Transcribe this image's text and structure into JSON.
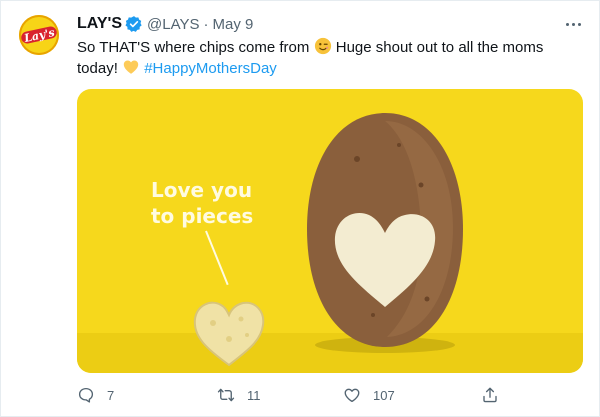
{
  "tweet": {
    "author_name": "LAY'S",
    "handle": "@LAYS",
    "separator": "·",
    "date": "May 9",
    "avatar_text": "Lay's",
    "text_part1": "So THAT'S where chips come from",
    "text_part2": "Huge shout out to all the moms today!",
    "hashtag": "#HappyMothersDay",
    "image_slogan_line1": "Love you",
    "image_slogan_line2": "to pieces"
  },
  "actions": {
    "reply_count": "7",
    "retweet_count": "11",
    "like_count": "107"
  },
  "colors": {
    "hashtag": "#1d9bf0",
    "secondary_text": "#536471",
    "image_background": "#f6d81c",
    "verified": "#1d9bf0"
  },
  "icons": [
    "verified-badge-icon",
    "more-options-icon",
    "winking-face-emoji",
    "yellow-heart-emoji",
    "reply-icon",
    "retweet-icon",
    "like-icon",
    "share-icon"
  ]
}
